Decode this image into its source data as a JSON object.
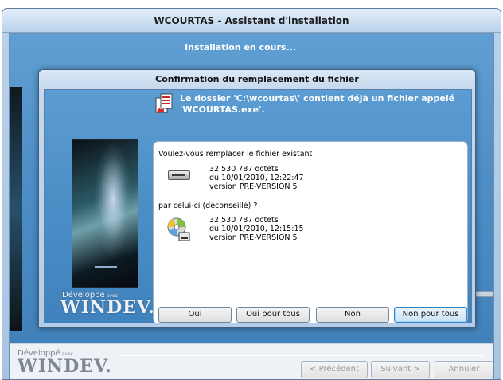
{
  "outer_window": {
    "title": "WCOURTAS - Assistant d'installation",
    "status": "Installation en cours...",
    "logo_top": "Développé",
    "logo_small": "avec",
    "logo_brand": "WINDEV.",
    "buttons": {
      "previous": "< Précédent",
      "next": "Suivant >",
      "cancel": "Annuler"
    }
  },
  "dialog": {
    "title": "Confirmation du remplacement du fichier",
    "message": "Le dossier 'C:\\wcourtas\\' contient déjà un fichier appelé 'WCOURTAS.exe'.",
    "question_existing": "Voulez-vous remplacer le fichier existant",
    "existing_file": {
      "size": "32 530 787 octets",
      "date": "du 10/01/2010, 12:22:47",
      "version": "version PRE-VERSION 5",
      "icon": "hard-drive-icon"
    },
    "question_new": "par celui-ci (déconseillé) ?",
    "new_file": {
      "size": "32 530 787 octets",
      "date": "du 10/01/2010, 12:15:15",
      "version": "version PRE-VERSION 5",
      "icon": "cd-drive-icon"
    },
    "logo_top": "Développé",
    "logo_small": "avec",
    "logo_brand": "WINDEV.",
    "buttons": {
      "yes": "Oui",
      "yes_all": "Oui pour tous",
      "no": "Non",
      "no_all": "Non pour tous"
    }
  },
  "colors": {
    "accent_blue": "#4f8fc6",
    "default_button": "#2f86c9",
    "title_bar": "#cddff2"
  }
}
